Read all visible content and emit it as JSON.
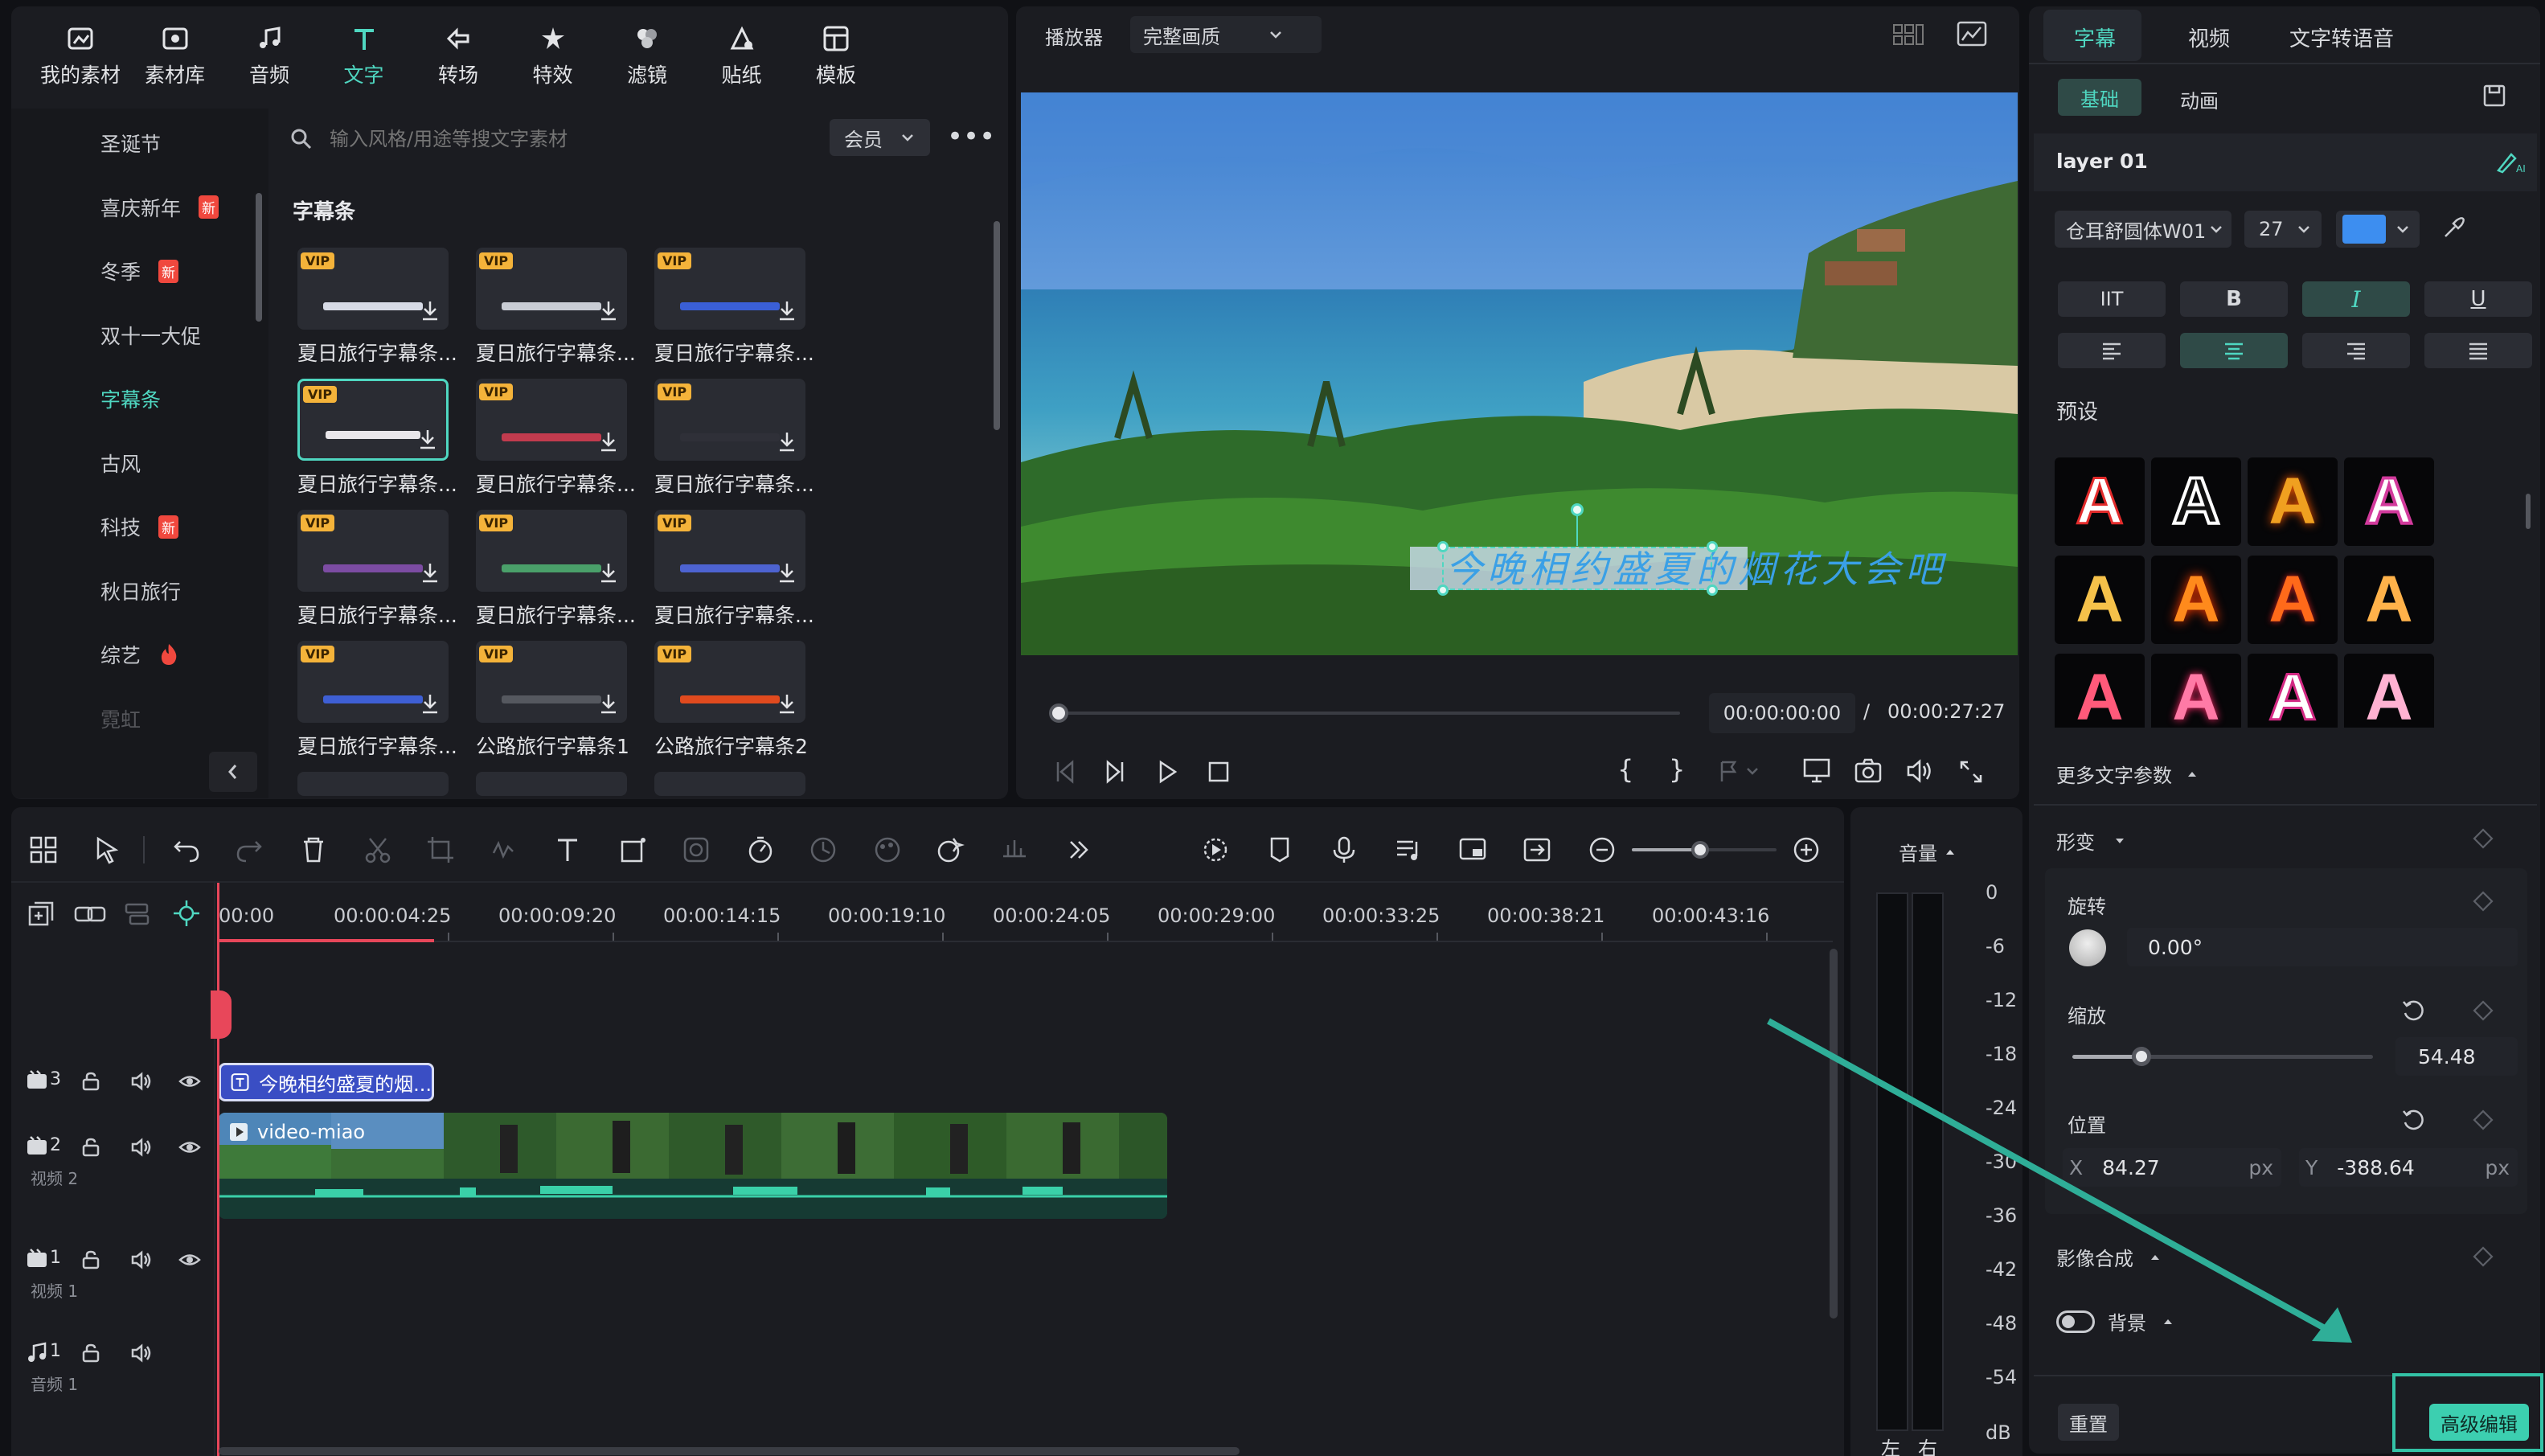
{
  "library": {
    "tools": [
      {
        "label": "我的素材",
        "icon": "media-icon"
      },
      {
        "label": "素材库",
        "icon": "stock-icon"
      },
      {
        "label": "音频",
        "icon": "music-icon"
      },
      {
        "label": "文字",
        "icon": "text-icon"
      },
      {
        "label": "转场",
        "icon": "transition-icon"
      },
      {
        "label": "特效",
        "icon": "effects-icon"
      },
      {
        "label": "滤镜",
        "icon": "filter-icon"
      },
      {
        "label": "贴纸",
        "icon": "sticker-icon"
      },
      {
        "label": "模板",
        "icon": "template-icon"
      }
    ],
    "active_tool": "文字",
    "categories": [
      {
        "label": "圣诞节"
      },
      {
        "label": "喜庆新年",
        "badge": "新"
      },
      {
        "label": "冬季",
        "badge": "新"
      },
      {
        "label": "双十一大促"
      },
      {
        "label": "字幕条"
      },
      {
        "label": "古风"
      },
      {
        "label": "科技",
        "badge": "新"
      },
      {
        "label": "秋日旅行"
      },
      {
        "label": "综艺",
        "badge": "fire"
      },
      {
        "label": "霓虹"
      }
    ],
    "active_category": "字幕条",
    "search_placeholder": "输入风格/用途等搜文字素材",
    "filter_label": "会员",
    "section_title": "字幕条",
    "vip_label": "VIP",
    "items": [
      {
        "name": "夏日旅行字幕条...",
        "color": "#d7dbe6"
      },
      {
        "name": "夏日旅行字幕条...",
        "color": "#c8ccd4"
      },
      {
        "name": "夏日旅行字幕条...",
        "color": "#3a5fd6"
      },
      {
        "name": "夏日旅行字幕条...",
        "color": "#e8e6ea"
      },
      {
        "name": "夏日旅行字幕条...",
        "color": "#c23b4e"
      },
      {
        "name": "夏日旅行字幕条...",
        "color": "#2f3038"
      },
      {
        "name": "夏日旅行字幕条...",
        "color": "#7c4ca3"
      },
      {
        "name": "夏日旅行字幕条...",
        "color": "#4aa06a"
      },
      {
        "name": "夏日旅行字幕条...",
        "color": "#4d63d1"
      },
      {
        "name": "夏日旅行字幕条...",
        "color": "#3e5fd4"
      },
      {
        "name": "公路旅行字幕条1",
        "color": "#55585f"
      },
      {
        "name": "公路旅行字幕条2",
        "color": "#e04a1e"
      }
    ]
  },
  "player": {
    "label": "播放器",
    "quality": "完整画质",
    "subtitle_text": "今晚相约盛夏的烟花大会吧",
    "current_time": "00:00:00:00",
    "separator": "/",
    "total_time": "00:00:27:27"
  },
  "inspector": {
    "tabs": [
      "字幕",
      "视频",
      "文字转语音"
    ],
    "active_tab": "字幕",
    "subtabs": [
      "基础",
      "动画"
    ],
    "active_subtab": "基础",
    "layer_name": "layer 01",
    "font": "仓耳舒圆体W01",
    "font_size": "27",
    "font_color": "#3d8ef0",
    "style_buttons": [
      "IIT",
      "B",
      "I",
      "U"
    ],
    "presets_label": "预设",
    "more_params_label": "更多文字参数",
    "transform_label": "形变",
    "rotate_label": "旋转",
    "rotate_value": "0.00°",
    "scale_label": "缩放",
    "scale_value": "54.48",
    "scale_level": 0.23,
    "position_label": "位置",
    "pos_x_label": "X",
    "pos_x": "84.27",
    "pos_y_label": "Y",
    "pos_y": "-388.64",
    "unit": "px",
    "compositing_label": "影像合成",
    "background_label": "背景",
    "reset_label": "重置",
    "advanced_label": "高级编辑",
    "accent": "#4fd7c1"
  },
  "timeline": {
    "ruler": [
      "00:00",
      "00:00:04:25",
      "00:00:09:20",
      "00:00:14:15",
      "00:00:19:10",
      "00:00:24:05",
      "00:00:29:00",
      "00:00:33:25",
      "00:00:38:21",
      "00:00:43:16"
    ],
    "tracks": [
      {
        "num": "3",
        "name": ""
      },
      {
        "num": "2",
        "name": "视频 2"
      },
      {
        "num": "1",
        "name": "视频 1"
      },
      {
        "num": "1",
        "name": "音频 1"
      }
    ],
    "text_clip": "今晚相约盛夏的烟...",
    "video_clip": "video-miao",
    "volume_label": "音量",
    "meter_scale": [
      "0",
      "-6",
      "-12",
      "-18",
      "-24",
      "-30",
      "-36",
      "-42",
      "-48",
      "-54"
    ],
    "meter_unit": "dB",
    "meter_left": "左",
    "meter_right": "右"
  }
}
